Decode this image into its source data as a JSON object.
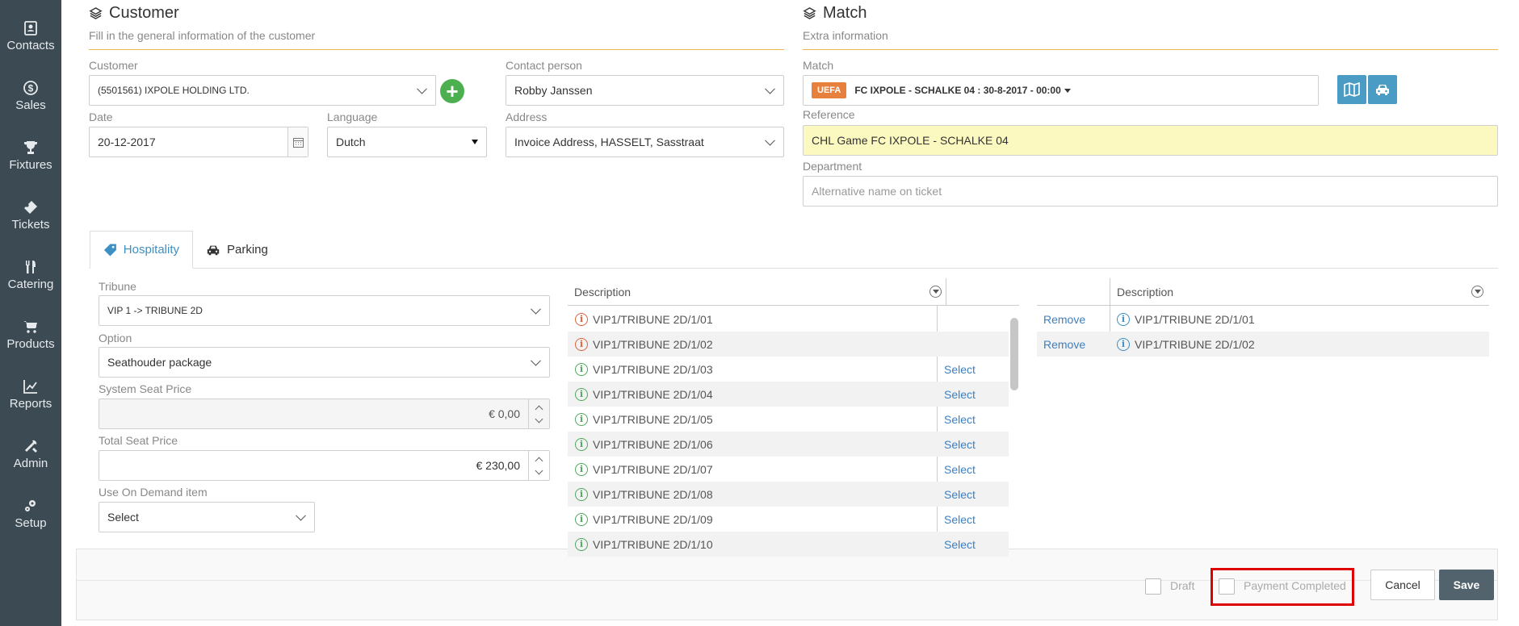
{
  "sidebar": {
    "items": [
      {
        "label": "Contacts",
        "icon": "contacts-icon"
      },
      {
        "label": "Sales",
        "icon": "sales-icon"
      },
      {
        "label": "Fixtures",
        "icon": "trophy-icon"
      },
      {
        "label": "Tickets",
        "icon": "ticket-icon"
      },
      {
        "label": "Catering",
        "icon": "cutlery-icon"
      },
      {
        "label": "Products",
        "icon": "cart-icon"
      },
      {
        "label": "Reports",
        "icon": "chart-icon"
      },
      {
        "label": "Admin",
        "icon": "tools-icon"
      },
      {
        "label": "Setup",
        "icon": "setup-icon"
      }
    ]
  },
  "customer_section": {
    "title": "Customer",
    "subtitle": "Fill in the general information of the customer",
    "customer_label": "Customer",
    "customer_value": "(5501561) IXPOLE HOLDING LTD.",
    "contact_label": "Contact person",
    "contact_value": "Robby Janssen",
    "date_label": "Date",
    "date_value": "20-12-2017",
    "language_label": "Language",
    "language_value": "Dutch",
    "address_label": "Address",
    "address_value": "Invoice Address, HASSELT, Sasstraat"
  },
  "match_section": {
    "title": "Match",
    "subtitle": "Extra information",
    "match_label": "Match",
    "match_badge": "UEFA",
    "match_value": "FC IXPOLE - SCHALKE 04 : 30-8-2017 - 00:00",
    "reference_label": "Reference",
    "reference_value": "CHL Game FC IXPOLE - SCHALKE 04",
    "department_label": "Department",
    "department_placeholder": "Alternative name on ticket"
  },
  "tabs": [
    {
      "label": "Hospitality",
      "active": true
    },
    {
      "label": "Parking",
      "active": false
    }
  ],
  "hospitality": {
    "tribune_label": "Tribune",
    "tribune_value": "VIP 1 -> TRIBUNE 2D",
    "option_label": "Option",
    "option_value": "Seathouder package",
    "system_price_label": "System Seat Price",
    "system_price_value": "€ 0,00",
    "total_price_label": "Total Seat Price",
    "total_price_value": "€ 230,00",
    "on_demand_label": "Use On Demand item",
    "on_demand_value": "Select"
  },
  "available_grid": {
    "header": "Description",
    "select_label": "Select",
    "rows": [
      {
        "desc": "VIP1/TRIBUNE 2D/1/01",
        "status": "red",
        "selectable": false
      },
      {
        "desc": "VIP1/TRIBUNE 2D/1/02",
        "status": "red",
        "selectable": false
      },
      {
        "desc": "VIP1/TRIBUNE 2D/1/03",
        "status": "green",
        "selectable": true
      },
      {
        "desc": "VIP1/TRIBUNE 2D/1/04",
        "status": "green",
        "selectable": true
      },
      {
        "desc": "VIP1/TRIBUNE 2D/1/05",
        "status": "green",
        "selectable": true
      },
      {
        "desc": "VIP1/TRIBUNE 2D/1/06",
        "status": "green",
        "selectable": true
      },
      {
        "desc": "VIP1/TRIBUNE 2D/1/07",
        "status": "green",
        "selectable": true
      },
      {
        "desc": "VIP1/TRIBUNE 2D/1/08",
        "status": "green",
        "selectable": true
      },
      {
        "desc": "VIP1/TRIBUNE 2D/1/09",
        "status": "green",
        "selectable": true
      },
      {
        "desc": "VIP1/TRIBUNE 2D/1/10",
        "status": "green",
        "selectable": true
      }
    ]
  },
  "selected_grid": {
    "header": "Description",
    "remove_label": "Remove",
    "rows": [
      {
        "desc": "VIP1/TRIBUNE 2D/1/01"
      },
      {
        "desc": "VIP1/TRIBUNE 2D/1/02"
      }
    ]
  },
  "footer": {
    "draft_label": "Draft",
    "payment_label": "Payment Completed",
    "cancel_label": "Cancel",
    "save_label": "Save"
  },
  "colors": {
    "sidebar_bg": "#3c4a53",
    "accent": "#3d8fc4",
    "section_line": "#e8b84a",
    "reference_bg": "#fbf9c0",
    "uefa_badge": "#e8803d",
    "highlight_box": "#e00000"
  }
}
